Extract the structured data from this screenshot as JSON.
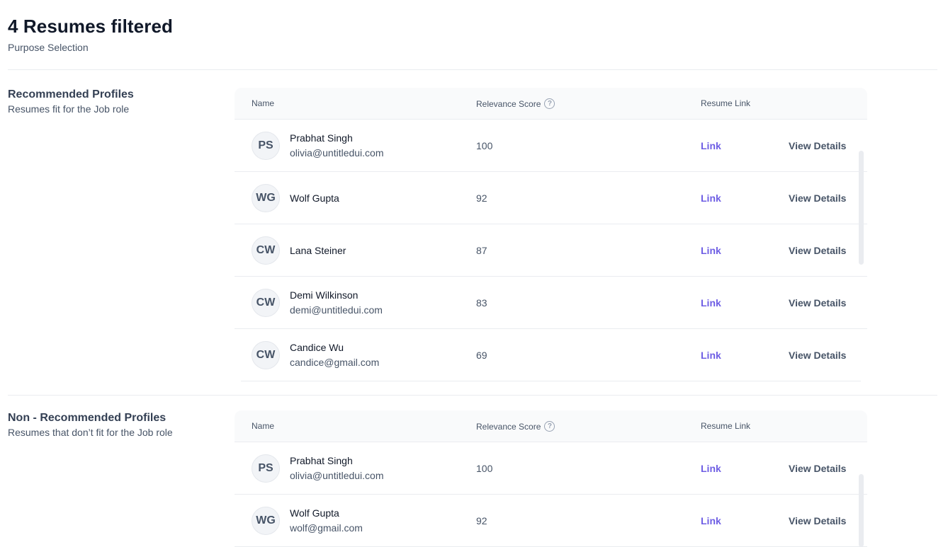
{
  "header": {
    "title": "4 Resumes filtered",
    "subtitle": "Purpose Selection"
  },
  "columns": {
    "name": "Name",
    "score": "Relevance Score",
    "score_help_icon": "help-circle-icon",
    "link": "Resume Link"
  },
  "recommended": {
    "title": "Recommended Profiles",
    "description": "Resumes fit for the Job role",
    "rows": [
      {
        "initials": "PS",
        "name": "Prabhat Singh",
        "email": "olivia@untitledui.com",
        "score": "100",
        "link": "Link",
        "action": "View Details"
      },
      {
        "initials": "WG",
        "name": "Wolf Gupta",
        "email": "",
        "score": "92",
        "link": "Link",
        "action": "View Details"
      },
      {
        "initials": "CW",
        "name": "Lana Steiner",
        "email": "",
        "score": "87",
        "link": "Link",
        "action": "View Details"
      },
      {
        "initials": "CW",
        "name": "Demi Wilkinson",
        "email": "demi@untitledui.com",
        "score": "83",
        "link": "Link",
        "action": "View Details"
      },
      {
        "initials": "CW",
        "name": "Candice Wu",
        "email": "candice@gmail.com",
        "score": "69",
        "link": "Link",
        "action": "View Details"
      }
    ]
  },
  "non_recommended": {
    "title": "Non - Recommended Profiles",
    "description": "Resumes that don’t fit for the Job role",
    "rows": [
      {
        "initials": "PS",
        "name": "Prabhat Singh",
        "email": "olivia@untitledui.com",
        "score": "100",
        "link": "Link",
        "action": "View Details"
      },
      {
        "initials": "WG",
        "name": "Wolf Gupta",
        "email": "wolf@gmail.com",
        "score": "92",
        "link": "Link",
        "action": "View Details"
      }
    ]
  },
  "colors": {
    "link": "#6e5ee4",
    "header_bg": "#f9fafb",
    "border": "#eaecf0"
  }
}
